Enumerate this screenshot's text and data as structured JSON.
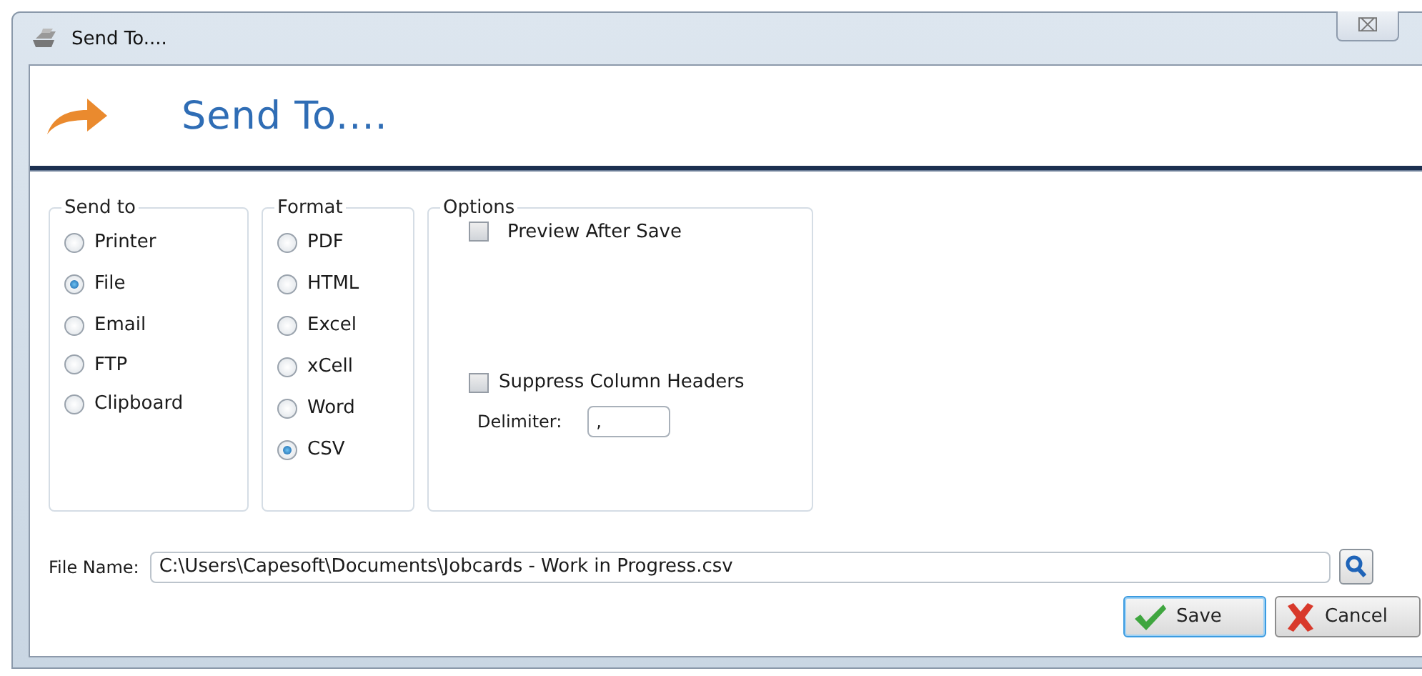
{
  "window": {
    "title": "Send To....",
    "close": "⌧"
  },
  "header": {
    "title": "Send To...."
  },
  "groups": [
    {
      "kind": "radio",
      "title": "Send to",
      "items": [
        {
          "label": "Printer",
          "selected": false
        },
        {
          "label": "File",
          "selected": true
        },
        {
          "label": "Email",
          "selected": false
        },
        {
          "label": "FTP",
          "selected": false
        },
        {
          "label": "Clipboard",
          "selected": false
        }
      ]
    },
    {
      "kind": "radio",
      "title": "Format",
      "items": [
        {
          "label": "PDF",
          "selected": false
        },
        {
          "label": "HTML",
          "selected": false
        },
        {
          "label": "Excel",
          "selected": false
        },
        {
          "label": "xCell",
          "selected": false
        },
        {
          "label": "Word",
          "selected": false
        },
        {
          "label": "CSV",
          "selected": true
        }
      ]
    },
    {
      "kind": "options",
      "title": "Options",
      "items": [
        {
          "kind": "checkbox",
          "label": "Preview After Save",
          "checked": false
        },
        {
          "kind": "checkbox",
          "label": "Suppress Column Headers",
          "checked": false,
          "field": {
            "label": "Delimiter:",
            "value": ","
          }
        }
      ]
    }
  ],
  "file_name": {
    "label": "File Name:",
    "value": "C:\\Users\\Capesoft\\Documents\\Jobcards - Work in Progress.csv"
  },
  "buttons": [
    {
      "kind": "save",
      "label": "Save",
      "default": true
    },
    {
      "kind": "cancel",
      "label": "Cancel",
      "default": false
    }
  ]
}
